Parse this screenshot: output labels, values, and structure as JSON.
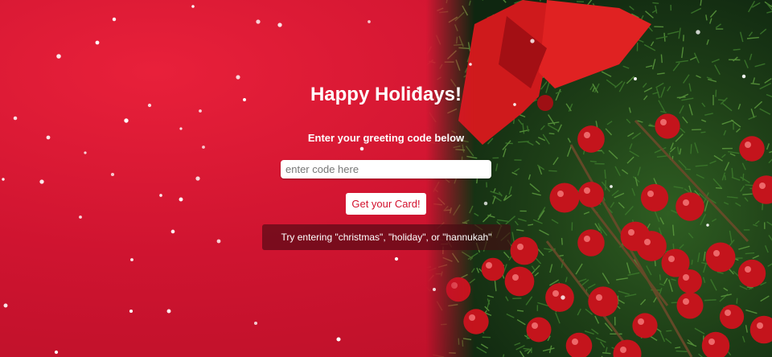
{
  "page": {
    "title": "Happy Holidays!",
    "subtitle": "Enter your greeting code below"
  },
  "form": {
    "code_input": {
      "value": "",
      "placeholder": "enter code here"
    },
    "submit_label": "Get your Card!"
  },
  "hint": {
    "text": "Try entering \"christmas\", \"holiday\", or \"hannukah\""
  },
  "theme": {
    "background": "#c8102e",
    "button_text": "#d3102c",
    "berry": "#c4141c",
    "greenery": "#1e3f17",
    "bow": "#d01818"
  },
  "decor": {
    "background_image": "christmas-wreath-berries-bow",
    "overlay": "falling-snow"
  }
}
